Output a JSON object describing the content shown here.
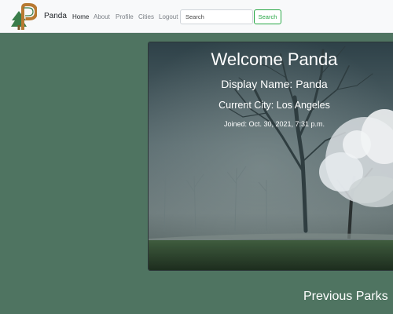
{
  "navbar": {
    "brand": "Panda",
    "links": [
      {
        "label": "Home",
        "active": true
      },
      {
        "label": "About",
        "active": false
      },
      {
        "label": "Profile",
        "active": false
      },
      {
        "label": "Cities",
        "active": false
      },
      {
        "label": "Logout",
        "active": false
      }
    ],
    "search": {
      "placeholder": "Search",
      "button_label": "Search"
    }
  },
  "hero": {
    "welcome": "Welcome Panda",
    "display_name": "Display Name: Panda",
    "current_city": "Current City: Los Angeles",
    "joined": "Joined: Oct. 30, 2021, 7:31 p.m."
  },
  "sections": {
    "previous_parks": "Previous Parks"
  },
  "colors": {
    "background": "#4f7461",
    "accent": "#28a745",
    "navbar": "#f8f9fa"
  },
  "icons": {
    "logo": "park-tree-p-logo"
  }
}
